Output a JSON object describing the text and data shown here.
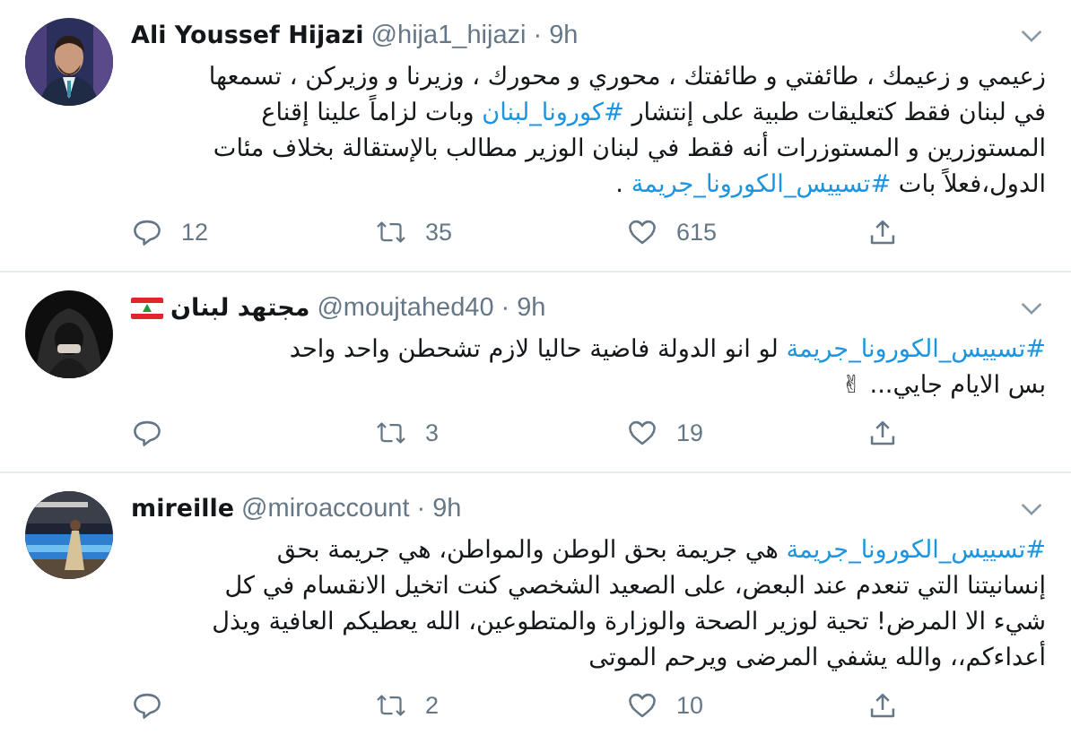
{
  "tweets": [
    {
      "name": "Ali Youssef Hijazi",
      "handle": "@hija1_hijazi",
      "separator": "·",
      "time": "9h",
      "avatar": {
        "kind": "picture"
      },
      "lines": [
        [
          {
            "kind": "text",
            "text": "زعيمي و زعيمك ، طائفتي و طائفتك ، محوري و محورك ، وزيرنا و وزيركن ، تسمعها"
          }
        ],
        [
          {
            "kind": "text",
            "text": "في لبنان فقط كتعليقات طبية على إنتشار "
          },
          {
            "kind": "hashtag",
            "text": "#كورونا_لبنان"
          },
          {
            "kind": "text",
            "text": " وبات لزاماً علينا إقناع"
          }
        ],
        [
          {
            "kind": "text",
            "text": "المستوزرين و المستوزرات أنه فقط في لبنان الوزير مطالب بالإستقالة بخلاف مئات"
          }
        ],
        [
          {
            "kind": "text",
            "text": "الدول،فعلاً بات "
          },
          {
            "kind": "hashtag",
            "text": "#تسييس_الكورونا_جريمة"
          },
          {
            "kind": "text",
            "text": " ."
          }
        ]
      ],
      "replies": "12",
      "retweets": "35",
      "likes": "615"
    },
    {
      "name": "مجتهد لبنان",
      "name_badge": {
        "kind": "flag"
      },
      "handle": "@moujtahed40",
      "separator": "·",
      "time": "9h",
      "avatar": {
        "kind": "picture"
      },
      "lines": [
        [
          {
            "kind": "hashtag",
            "text": "#تسييس_الكورونا_جريمة"
          },
          {
            "kind": "text",
            "text": " لو انو الدولة فاضية حاليا لازم تشحطن واحد واحد"
          }
        ],
        [
          {
            "kind": "text",
            "text": "بس الايام جايي... ✌"
          }
        ]
      ],
      "retweets": "3",
      "likes": "19"
    },
    {
      "name": "mireille",
      "handle": "@miroaccount",
      "separator": "·",
      "time": "9h",
      "avatar": {
        "kind": "picture"
      },
      "lines": [
        [
          {
            "kind": "hashtag",
            "text": "#تسييس_الكورونا_جريمة"
          },
          {
            "kind": "text",
            "text": " هي جريمة بحق الوطن والمواطن، هي جريمة بحق"
          }
        ],
        [
          {
            "kind": "text",
            "text": "إنسانيتنا التي تنعدم عند البعض، على الصعيد الشخصي كنت اتخيل الانقسام في كل"
          }
        ],
        [
          {
            "kind": "text",
            "text": "شيء الا المرض! تحية لوزير الصحة والوزارة والمتطوعين، الله يعطيكم العافية ويذل"
          }
        ],
        [
          {
            "kind": "text",
            "text": "أعداءكم،، والله يشفي المرضى ويرحم الموتى"
          }
        ]
      ],
      "retweets": "2",
      "likes": "10"
    }
  ]
}
